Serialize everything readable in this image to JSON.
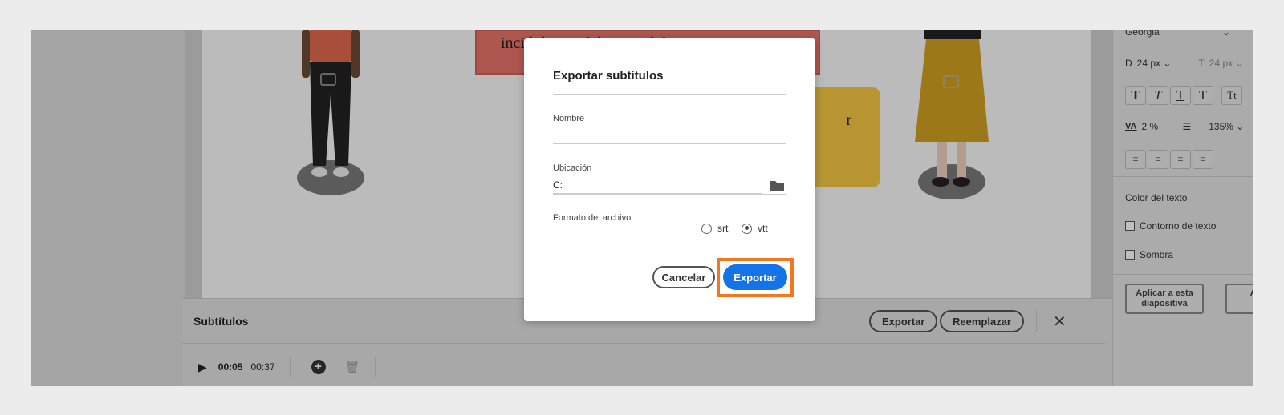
{
  "slide": {
    "red_box_text": "incididunt ut labore et dolore",
    "yellow_box_text": "r"
  },
  "right_panel": {
    "font_name": "Georgia",
    "size_label_d": "D",
    "size_value_d": "24 px",
    "size_label_t": "T",
    "size_value_t": "24 px",
    "tracking": "2 %",
    "line_spacing": "135%",
    "text_color_label": "Color del texto",
    "outline_label": "Contorno de texto",
    "shadow_label": "Sombra",
    "apply_slide_label": "Aplicar a esta diapositiva",
    "apply_all_label": "Aplic d"
  },
  "subtitles_panel": {
    "title": "Subtítulos",
    "export_label": "Exportar",
    "replace_label": "Reemplazar",
    "time_current": "00:05",
    "time_total": "00:37"
  },
  "dialog": {
    "title": "Exportar subtítulos",
    "name_label": "Nombre",
    "name_value": "",
    "location_label": "Ubicación",
    "location_value": "C:",
    "format_label": "Formato del archivo",
    "format_options": [
      "srt",
      "vtt"
    ],
    "format_selected": "vtt",
    "cancel_label": "Cancelar",
    "export_label": "Exportar"
  },
  "colors": {
    "primary_button": "#1473e6",
    "highlight": "#f07820"
  }
}
